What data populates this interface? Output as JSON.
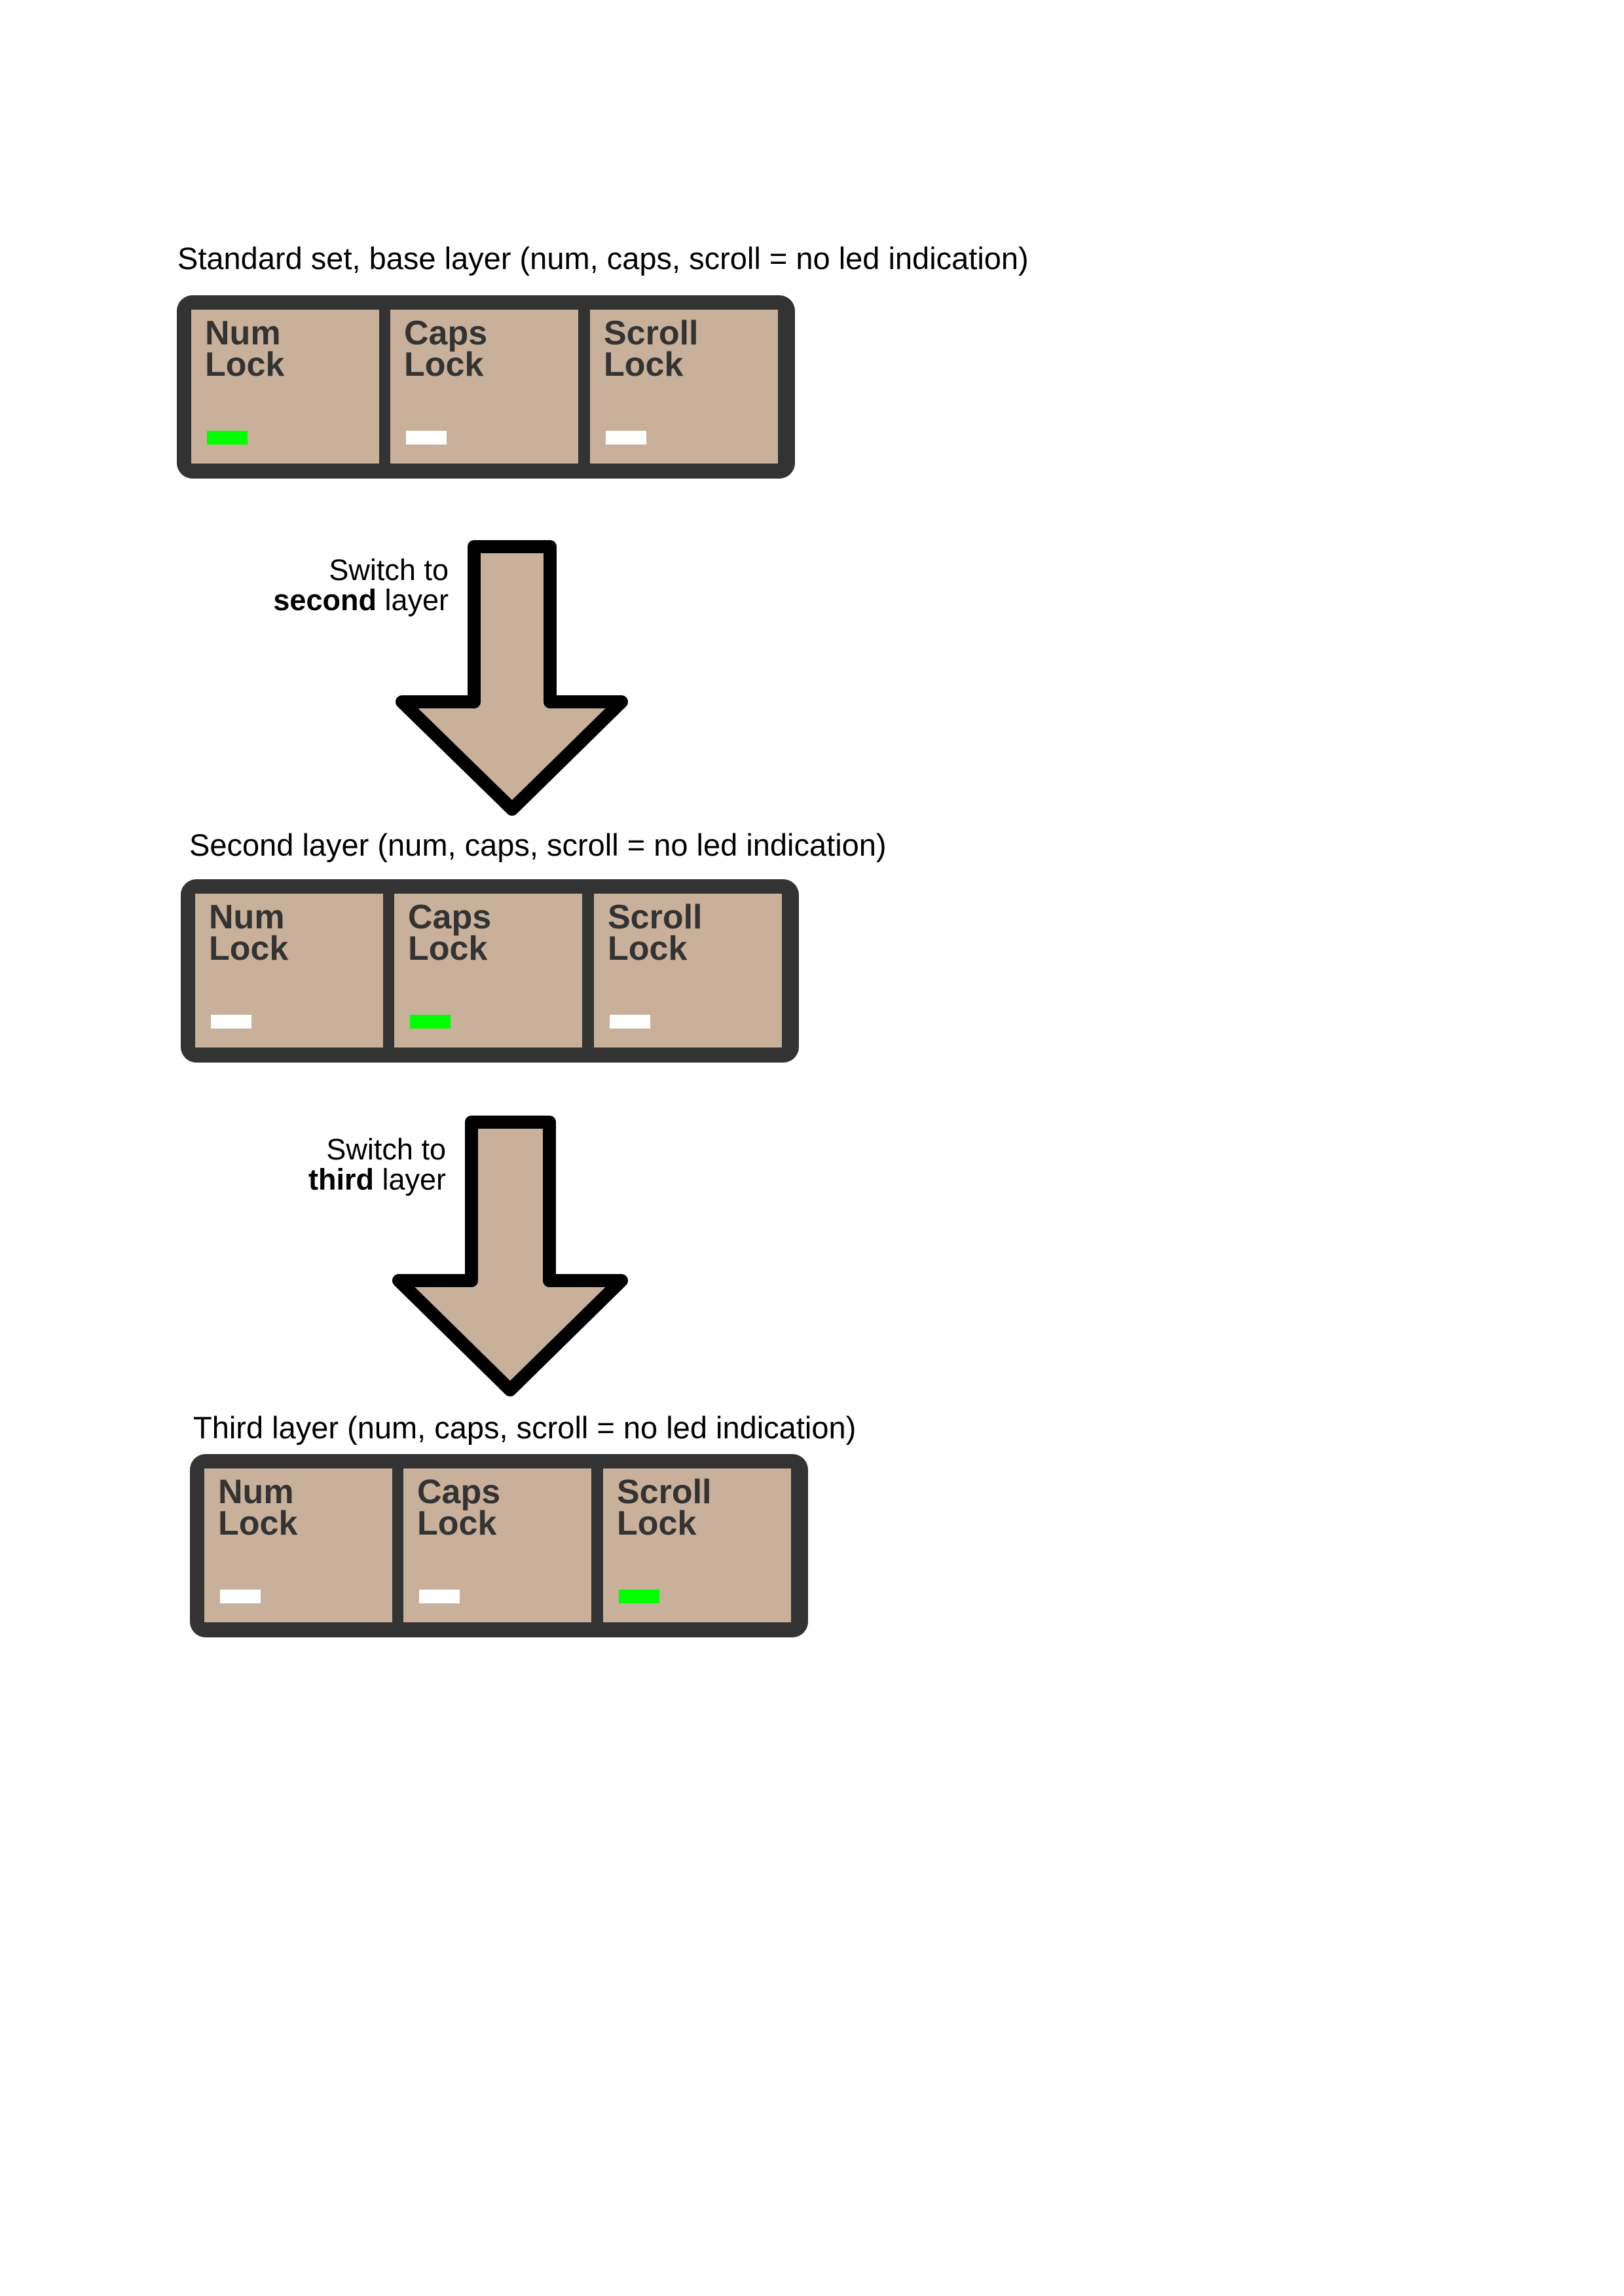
{
  "colors": {
    "panel_frame": "#333333",
    "key_fill": "#c8b09a",
    "key_text": "#333333",
    "led_on": "#00ff00",
    "led_off": "#ffffff",
    "arrow_fill": "#c8b09a",
    "arrow_stroke": "#000000"
  },
  "layers": [
    {
      "title": "Standard set, base layer (num, caps, scroll = no led indication)",
      "keys": [
        {
          "line1": "Num",
          "line2": "Lock",
          "led": "on"
        },
        {
          "line1": "Caps",
          "line2": "Lock",
          "led": "off"
        },
        {
          "line1": "Scroll",
          "line2": "Lock",
          "led": "off"
        }
      ]
    },
    {
      "title": "Second layer (num, caps, scroll = no led indication)",
      "keys": [
        {
          "line1": "Num",
          "line2": "Lock",
          "led": "off"
        },
        {
          "line1": "Caps",
          "line2": "Lock",
          "led": "on"
        },
        {
          "line1": "Scroll",
          "line2": "Lock",
          "led": "off"
        }
      ]
    },
    {
      "title": "Third layer (num, caps, scroll = no led indication)",
      "keys": [
        {
          "line1": "Num",
          "line2": "Lock",
          "led": "off"
        },
        {
          "line1": "Caps",
          "line2": "Lock",
          "led": "off"
        },
        {
          "line1": "Scroll",
          "line2": "Lock",
          "led": "on"
        }
      ]
    }
  ],
  "transitions": [
    {
      "line1": "Switch to",
      "bold": "second",
      "rest": " layer"
    },
    {
      "line1": "Switch to",
      "bold": "third",
      "rest": " layer"
    }
  ]
}
